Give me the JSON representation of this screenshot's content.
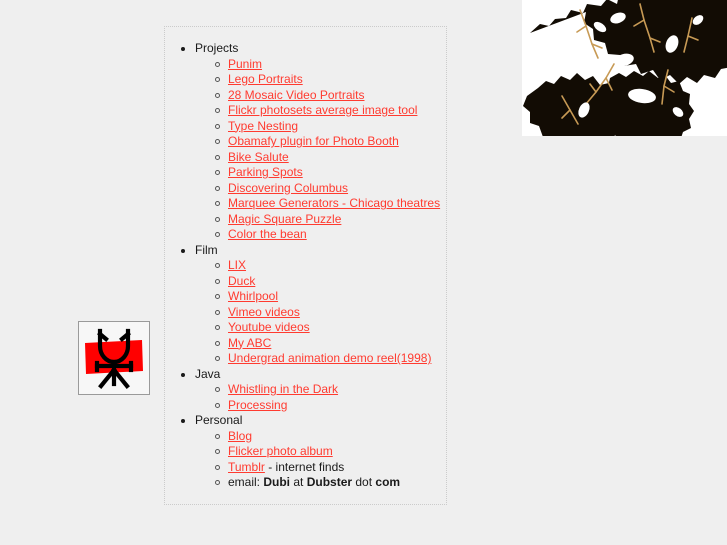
{
  "page": {
    "background_color": "#efefef",
    "link_color": "#ff3b30",
    "text_color": "#1a1a1a",
    "panel_border_color": "#cbcbcb"
  },
  "logo": {
    "alt": "stickman-logo",
    "red_color": "#ff0000",
    "figure_color": "#000000",
    "border_color": "#9a9a9a"
  },
  "photo": {
    "alt": "black-and-white-leaves-silhouette",
    "background_color": "#ffffff",
    "silhouette_color": "#120c04"
  },
  "sections": [
    {
      "label": "Projects",
      "items": [
        {
          "text": "Punim",
          "link": true
        },
        {
          "text": "Lego Portraits",
          "link": true
        },
        {
          "text": "28 Mosaic Video Portraits",
          "link": true
        },
        {
          "text": "Flickr photosets average image tool",
          "link": true
        },
        {
          "text": "Type Nesting",
          "link": true
        },
        {
          "text": "Obamafy plugin for Photo Booth",
          "link": true
        },
        {
          "text": "Bike Salute",
          "link": true
        },
        {
          "text": "Parking Spots",
          "link": true
        },
        {
          "text": "Discovering Columbus",
          "link": true
        },
        {
          "text": "Marquee Generators - Chicago theatres",
          "link": true
        },
        {
          "text": "Magic Square Puzzle",
          "link": true
        },
        {
          "text": "Color the bean",
          "link": true
        }
      ]
    },
    {
      "label": "Film",
      "items": [
        {
          "text": "LIX",
          "link": true
        },
        {
          "text": "Duck",
          "link": true
        },
        {
          "text": "Whirlpool",
          "link": true
        },
        {
          "text": "Vimeo videos",
          "link": true
        },
        {
          "text": "Youtube videos",
          "link": true
        },
        {
          "text": "My ABC",
          "link": true
        },
        {
          "text": "Undergrad animation demo reel(1998)",
          "link": true
        }
      ]
    },
    {
      "label": "Java",
      "items": [
        {
          "text": "Whistling in the Dark",
          "link": true
        },
        {
          "text": "Processing",
          "link": true
        }
      ]
    },
    {
      "label": "Personal",
      "items": [
        {
          "text": "Blog",
          "link": true
        },
        {
          "text": "Flicker photo album ",
          "link": true
        },
        {
          "text": "Tumblr",
          "link": true,
          "suffix": " - internet finds"
        },
        {
          "link": false,
          "parts": [
            {
              "text": "email: ",
              "style": "plain"
            },
            {
              "text": "Dubi",
              "style": "bold"
            },
            {
              "text": " at ",
              "style": "plain"
            },
            {
              "text": "Dubster",
              "style": "bold"
            },
            {
              "text": " dot ",
              "style": "plain"
            },
            {
              "text": "com",
              "style": "bold"
            }
          ]
        }
      ]
    }
  ]
}
